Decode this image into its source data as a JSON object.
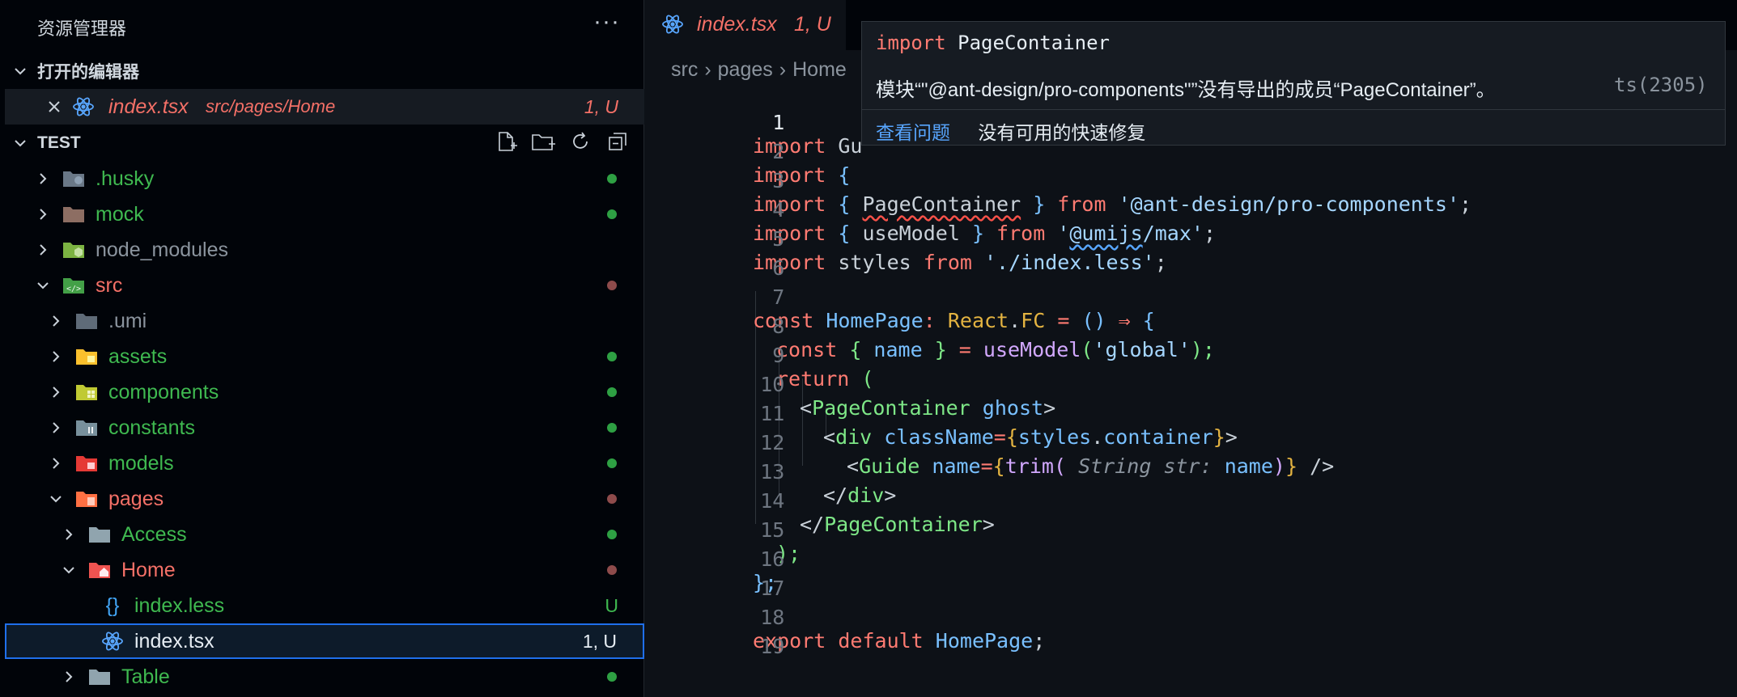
{
  "sidebar": {
    "title": "资源管理器",
    "more": "···",
    "open_editors": {
      "title": "打开的编辑器",
      "file": {
        "name": "index.tsx",
        "path": "src/pages/Home",
        "status": "1, U"
      }
    },
    "workspace": {
      "title": "TEST",
      "toolbar": [
        "new-file-icon",
        "new-folder-icon",
        "refresh-icon",
        "collapse-all-icon"
      ]
    },
    "tree": [
      {
        "label": ".husky",
        "color": "green",
        "dot": "green"
      },
      {
        "label": "mock",
        "color": "green",
        "dot": "green"
      },
      {
        "label": "node_modules",
        "color": "grey"
      },
      {
        "label": "src",
        "color": "red",
        "dot": "red"
      },
      {
        "label": ".umi",
        "color": "grey"
      },
      {
        "label": "assets",
        "color": "green",
        "dot": "green"
      },
      {
        "label": "components",
        "color": "green",
        "dot": "green"
      },
      {
        "label": "constants",
        "color": "green",
        "dot": "green"
      },
      {
        "label": "models",
        "color": "green",
        "dot": "green"
      },
      {
        "label": "pages",
        "color": "red",
        "dot": "red"
      },
      {
        "label": "Access",
        "color": "green",
        "dot": "green"
      },
      {
        "label": "Home",
        "color": "red",
        "dot": "red"
      },
      {
        "label": "index.less",
        "color": "green",
        "status": "U"
      },
      {
        "label": "index.tsx",
        "color": "white",
        "status": "1, U"
      },
      {
        "label": "Table",
        "color": "green",
        "dot": "green"
      }
    ]
  },
  "editor": {
    "tab": {
      "name": "index.tsx",
      "status": "1, U"
    },
    "breadcrumb": [
      "src",
      "pages",
      "Home"
    ],
    "line_numbers": [
      "1",
      "2",
      "3",
      "4",
      "5",
      "6",
      "7",
      "8",
      "9",
      "10",
      "11",
      "12",
      "13",
      "14",
      "15",
      "16",
      "17",
      "18",
      "19"
    ],
    "code": {
      "l1": [
        "import",
        " Gu"
      ],
      "l2": [
        "import",
        " {"
      ],
      "l3": [
        "import",
        " { ",
        "PageContainer",
        " } ",
        "from",
        " '@ant-design/pro-components'",
        ";"
      ],
      "l4": [
        "import",
        " { ",
        "useModel",
        " } ",
        "from",
        " '",
        "@umijs",
        "/max'",
        ";"
      ],
      "l5": [
        "import",
        " styles ",
        "from",
        " './index.less'",
        ";"
      ],
      "l7": [
        "const",
        " HomePage",
        ": ",
        "React",
        ".",
        "FC",
        " = ",
        "()",
        " ⇒ ",
        "{"
      ],
      "l8": [
        "const",
        " { ",
        "name",
        " } ",
        "= ",
        "useModel",
        "(",
        "'global'",
        ");"
      ],
      "l9": [
        "return",
        " ("
      ],
      "l10": [
        "<",
        "PageContainer",
        " ",
        "ghost",
        ">"
      ],
      "l11": [
        "<",
        "div",
        " ",
        "className",
        "=",
        "{",
        "styles",
        ".",
        "container",
        "}",
        ">"
      ],
      "l12": [
        "<",
        "Guide",
        " ",
        "name",
        "=",
        "{",
        "trim",
        "(",
        " String str:",
        " ",
        "name",
        ")",
        "}",
        " />"
      ],
      "l13": [
        "</",
        "div",
        ">"
      ],
      "l14": [
        "</",
        "PageContainer",
        ">"
      ],
      "l15": [
        ");"
      ],
      "l16": [
        "};"
      ],
      "l18": [
        "export",
        " default",
        " HomePage",
        ";"
      ]
    }
  },
  "hover": {
    "line1_kw": "import",
    "line1_name": " PageContainer",
    "message": "模块“\"@ant-design/pro-components\"”没有导出的成员“PageContainer”。",
    "code": "ts(2305)",
    "view_problem": "查看问题",
    "no_fix": "没有可用的快速修复"
  }
}
